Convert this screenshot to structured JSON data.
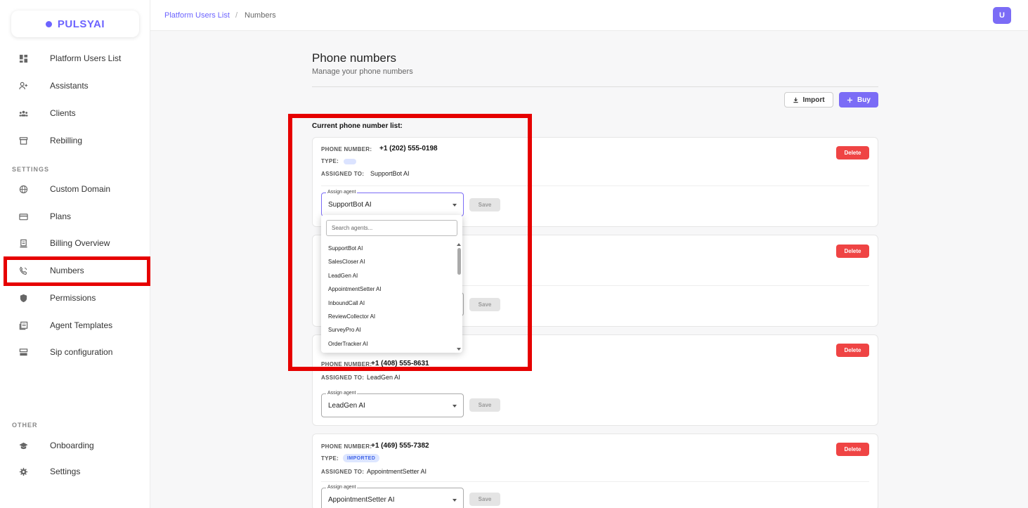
{
  "brand": {
    "name": "PULSYAI",
    "accent": "#6c63ff"
  },
  "sidebar": {
    "items": [
      {
        "label": "Platform Users List",
        "icon": "dashboard-icon"
      },
      {
        "label": "Assistants",
        "icon": "person-add-icon"
      },
      {
        "label": "Clients",
        "icon": "group-icon"
      },
      {
        "label": "Rebilling",
        "icon": "store-icon"
      }
    ],
    "settings_label": "SETTINGS",
    "settings_items": [
      {
        "label": "Custom Domain",
        "icon": "globe-icon"
      },
      {
        "label": "Plans",
        "icon": "card-icon"
      },
      {
        "label": "Billing Overview",
        "icon": "receipt-icon"
      },
      {
        "label": "Numbers",
        "icon": "phone-icon"
      },
      {
        "label": "Permissions",
        "icon": "shield-icon"
      },
      {
        "label": "Agent Templates",
        "icon": "template-icon"
      },
      {
        "label": "Sip configuration",
        "icon": "server-icon"
      }
    ],
    "other_label": "OTHER",
    "other_items": [
      {
        "label": "Onboarding",
        "icon": "school-icon"
      },
      {
        "label": "Settings",
        "icon": "gear-icon"
      }
    ]
  },
  "header": {
    "breadcrumb": [
      "Platform Users List",
      "Numbers"
    ],
    "separator": "/",
    "avatar": "U"
  },
  "main": {
    "title": "Phone numbers",
    "subtitle": "Manage your phone numbers",
    "import_label": "Import",
    "buy_label": "Buy",
    "list_title": "Current phone number list:",
    "labels": {
      "phone": "PHONE NUMBER:",
      "type": "TYPE:",
      "assigned": "ASSIGNED TO:",
      "assign_agent": "Assign agent",
      "delete": "Delete",
      "save": "Save"
    },
    "cards": [
      {
        "phone": "+1 (202) 555-0198",
        "type": "",
        "assigned": "SupportBot AI",
        "agent": "SupportBot AI"
      },
      {
        "phone": "",
        "type": "",
        "assigned": "",
        "agent": ""
      },
      {
        "phone": "+1 (408) 555-8631",
        "type": "",
        "assigned": "LeadGen AI",
        "agent": "LeadGen AI"
      },
      {
        "phone": "+1 (469) 555-7382",
        "type": "IMPORTED",
        "assigned": "AppointmentSetter AI",
        "agent": "AppointmentSetter AI"
      }
    ]
  },
  "dropdown": {
    "search_placeholder": "Search agents...",
    "options": [
      "SupportBot AI",
      "SalesCloser AI",
      "LeadGen AI",
      "AppointmentSetter AI",
      "InboundCall AI",
      "ReviewCollector AI",
      "SurveyPro AI",
      "OrderTracker AI"
    ]
  }
}
